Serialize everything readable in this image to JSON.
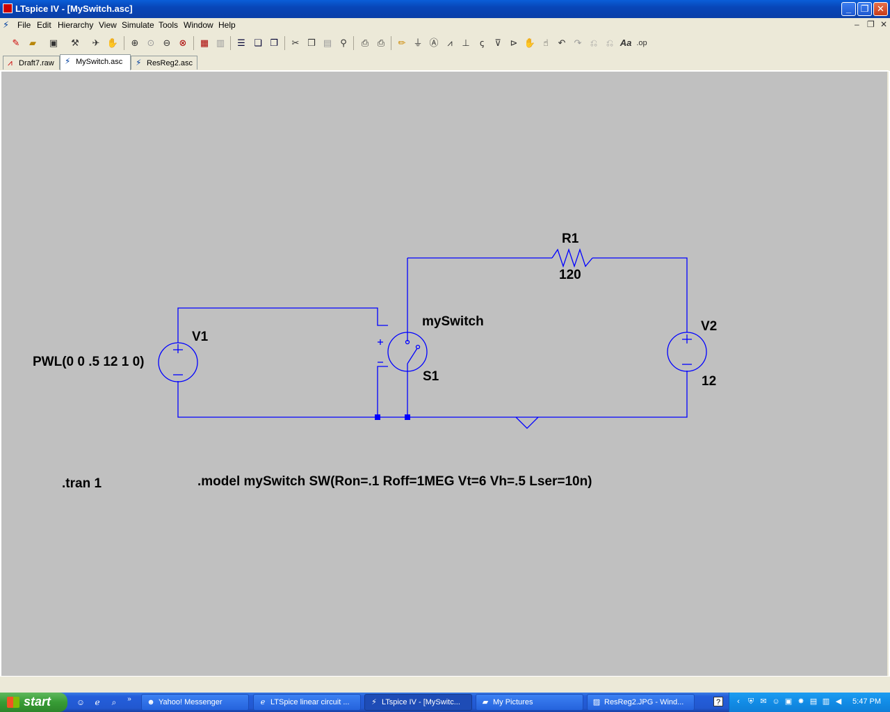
{
  "window": {
    "title": "LTspice IV - [MySwitch.asc]"
  },
  "menu": [
    "File",
    "Edit",
    "Hierarchy",
    "View",
    "Simulate",
    "Tools",
    "Window",
    "Help"
  ],
  "tabs": [
    {
      "label": "Draft7.raw",
      "icon": "waveform-icon"
    },
    {
      "label": "MySwitch.asc",
      "icon": "schematic-icon",
      "active": true
    },
    {
      "label": "ResReg2.asc",
      "icon": "schematic-icon"
    }
  ],
  "schematic": {
    "r1": {
      "name": "R1",
      "value": "120"
    },
    "v1": {
      "name": "V1",
      "value": "PWL(0 0 .5 12 1 0)"
    },
    "v2": {
      "name": "V2",
      "value": "12"
    },
    "s1": {
      "name": "S1",
      "model": "mySwitch"
    },
    "directives": {
      "tran": ".tran 1",
      "model": ".model mySwitch SW(Ron=.1 Roff=1MEG Vt=6 Vh=.5 Lser=10n)"
    },
    "wire_color": "#0000ff",
    "background_color": "#c0c0c0"
  },
  "taskbar": {
    "start_label": "start",
    "tasks": [
      {
        "label": "Yahoo! Messenger",
        "icon": "yahoo-icon"
      },
      {
        "label": "LTSpice linear circuit ...",
        "icon": "ie-icon"
      },
      {
        "label": "LTspice IV - [MySwitc...",
        "icon": "ltspice-icon",
        "active": true
      },
      {
        "label": "My Pictures",
        "icon": "folder-icon"
      },
      {
        "label": "ResReg2.JPG - Wind...",
        "icon": "image-viewer-icon"
      }
    ],
    "clock": "5:47 PM"
  }
}
